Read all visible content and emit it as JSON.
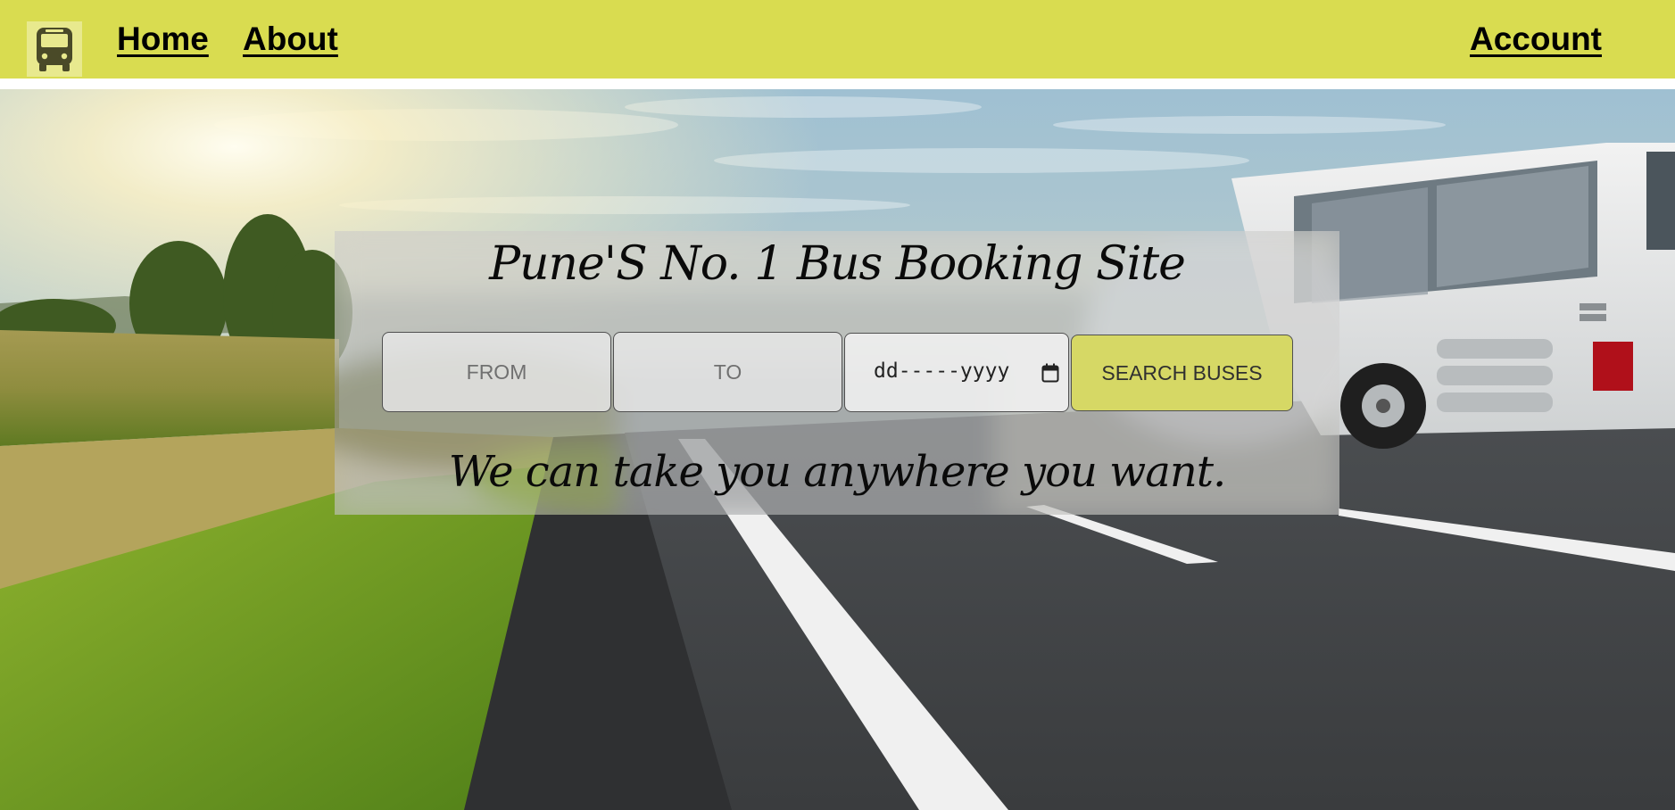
{
  "nav": {
    "logo_icon": "bus-icon",
    "home_label": "Home",
    "about_label": "About",
    "account_label": "Account",
    "bar_color": "#d9dc50"
  },
  "hero": {
    "title": "Pune'S No. 1 Bus Booking Site",
    "tagline": "We can take you anywhere you want."
  },
  "search": {
    "from_placeholder": "FROM",
    "from_value": "",
    "to_placeholder": "TO",
    "to_value": "",
    "date_placeholder": "dd-----yyyy",
    "date_icon": "calendar-icon",
    "button_label": "SEARCH BUSES",
    "button_color": "#d6d865"
  }
}
